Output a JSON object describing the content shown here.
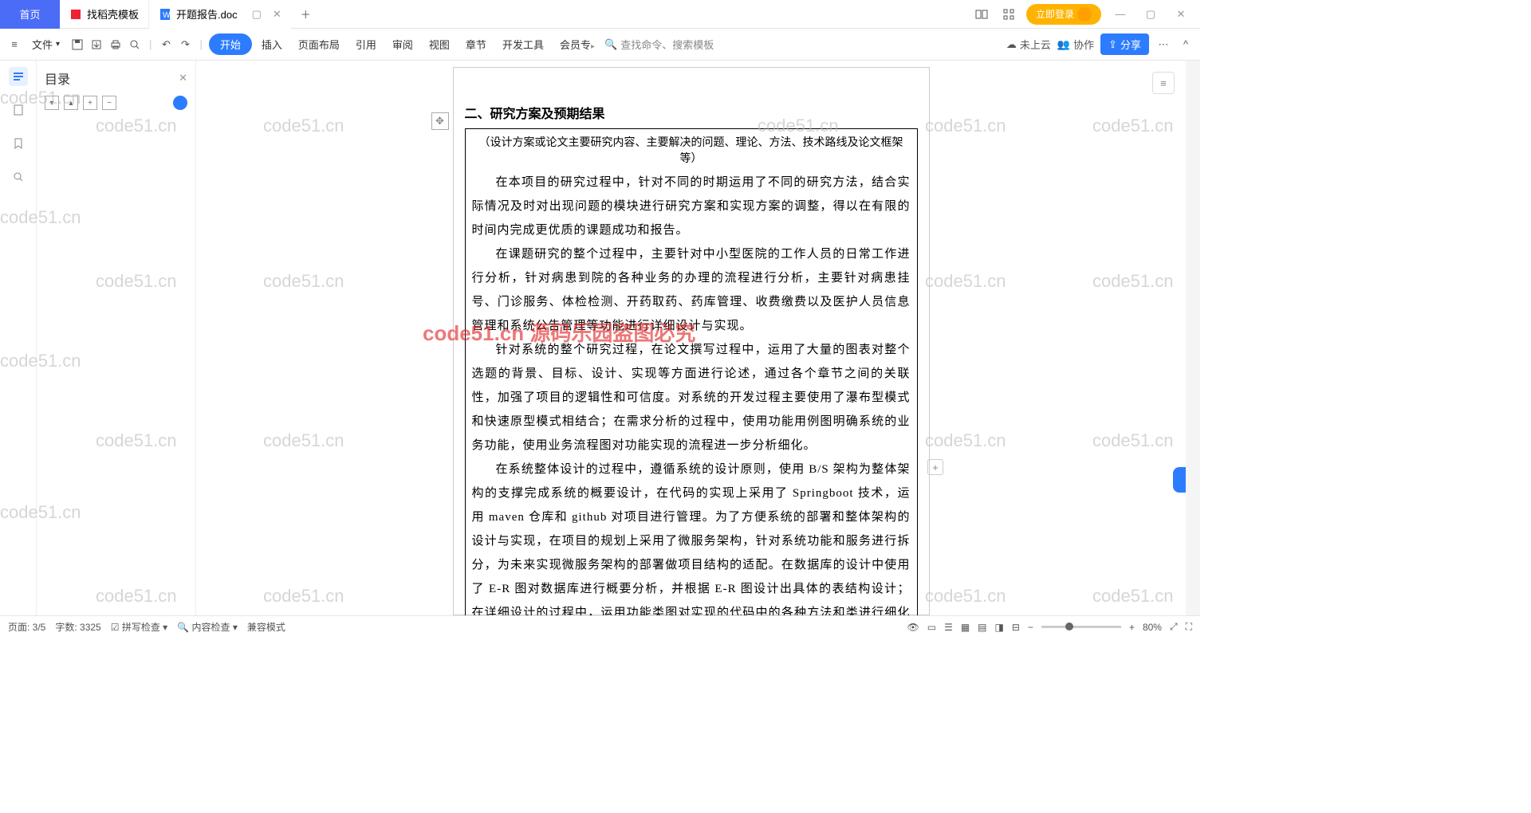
{
  "tabs": {
    "home": "首页",
    "template": "找稻壳模板",
    "doc": "开题报告.doc"
  },
  "titlebar": {
    "login": "立即登录"
  },
  "ribbon": {
    "file": "文件",
    "start": "开始",
    "insert": "插入",
    "layout": "页面布局",
    "ref": "引用",
    "review": "审阅",
    "view": "视图",
    "chapter": "章节",
    "dev": "开发工具",
    "member": "会员专",
    "search": "查找命令、搜索模板",
    "cloud": "未上云",
    "collab": "协作",
    "share": "分享"
  },
  "outline": {
    "title": "目录"
  },
  "document": {
    "heading": "二、研究方案及预期结果",
    "subtitle": "（设计方案或论文主要研究内容、主要解决的问题、理论、方法、技术路线及论文框架等）",
    "p1": "在本项目的研究过程中，针对不同的时期运用了不同的研究方法，结合实际情况及时对出现问题的模块进行研究方案和实现方案的调整，得以在有限的时间内完成更优质的课题成功和报告。",
    "p2": "在课题研究的整个过程中，主要针对中小型医院的工作人员的日常工作进行分析，针对病患到院的各种业务的办理的流程进行分析，主要针对病患挂号、门诊服务、体检检测、开药取药、药库管理、收费缴费以及医护人员信息管理和系统公告管理等功能进行详细设计与实现。",
    "p3": "针对系统的整个研究过程，在论文撰写过程中，运用了大量的图表对整个选题的背景、目标、设计、实现等方面进行论述，通过各个章节之间的关联性，加强了项目的逻辑性和可信度。对系统的开发过程主要使用了瀑布型模式和快速原型模式相结合；在需求分析的过程中，使用功能用例图明确系统的业务功能，使用业务流程图对功能实现的流程进一步分析细化。",
    "p4": "在系统整体设计的过程中，遵循系统的设计原则，使用 B/S 架构为整体架构的支撑完成系统的概要设计，在代码的实现上采用了 Springboot 技术，运用 maven 仓库和 github 对项目进行管理。为了方便系统的部署和整体架构的设计与实现，在项目的规划上采用了微服务架构，针对系统功能和服务进行拆分，为未来实现微服务架构的部署做项目结构的适配。在数据库的设计中使用了 E-R 图对数据库进行概要分析，并根据 E-R 图设计出具体的表结构设计；在详细设计的过程中，运用功能类图对实现的代码中的各种方法和类进行细化和归纳；在系统测试环节，使用了黑盒测试和白盒测试的方式对系"
  },
  "status": {
    "page": "页面: 3/5",
    "words": "字数: 3325",
    "spell": "拼写检查",
    "content": "内容检查",
    "compat": "兼容模式",
    "zoom": "80%"
  },
  "watermarks": {
    "grey": "code51.cn",
    "red": "code51.cn 源码乐园盗图必究"
  }
}
